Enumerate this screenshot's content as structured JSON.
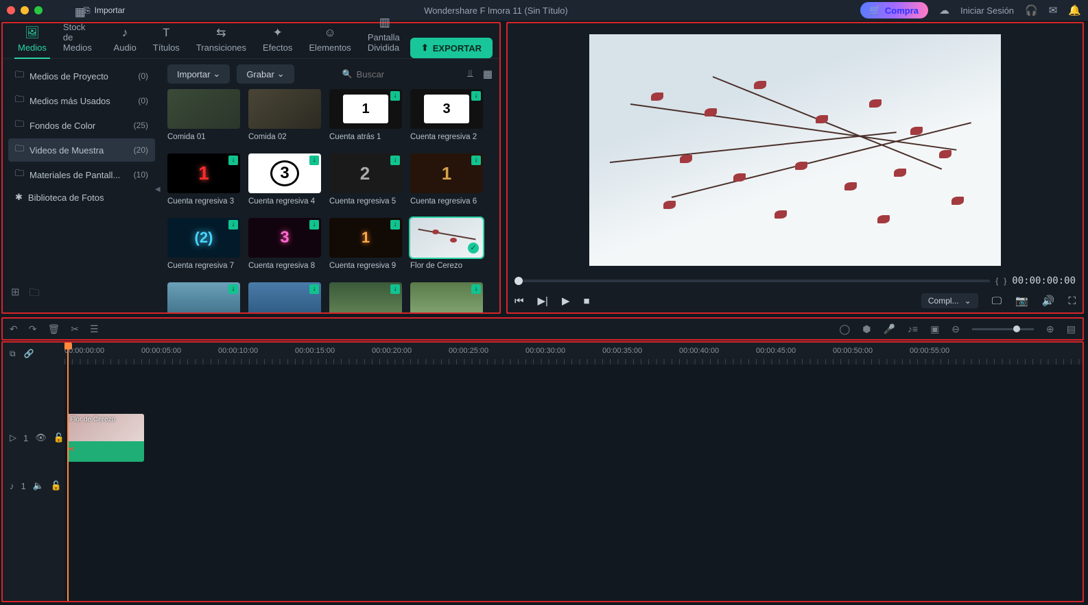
{
  "titlebar": {
    "import": "Importar",
    "app_title": "Wondershare F lmora 11 (Sin Título)",
    "compra": "Compra",
    "login": "Iniciar Sesión"
  },
  "tabs": [
    {
      "label": "Medios",
      "active": true
    },
    {
      "label": "Stock de Medios",
      "active": false
    },
    {
      "label": "Audio",
      "active": false
    },
    {
      "label": "Títulos",
      "active": false
    },
    {
      "label": "Transiciones",
      "active": false
    },
    {
      "label": "Efectos",
      "active": false
    },
    {
      "label": "Elementos",
      "active": false
    },
    {
      "label": "Pantalla Dividida",
      "active": false
    }
  ],
  "export": "EXPORTAR",
  "toolbar": {
    "import": "Importar",
    "record": "Grabar",
    "search_placeholder": "Buscar"
  },
  "sidebar": {
    "items": [
      {
        "label": "Medios de Proyecto",
        "count": "(0)",
        "active": false,
        "icon": "folder"
      },
      {
        "label": "Medios más Usados",
        "count": "(0)",
        "active": false,
        "icon": "folder"
      },
      {
        "label": "Fondos de Color",
        "count": "(25)",
        "active": false,
        "icon": "folder"
      },
      {
        "label": "Videos de Muestra",
        "count": "(20)",
        "active": true,
        "icon": "folder"
      },
      {
        "label": "Materiales de Pantall...",
        "count": "(10)",
        "active": false,
        "icon": "folder"
      },
      {
        "label": "Biblioteca de Fotos",
        "count": "",
        "active": false,
        "icon": "sparkle"
      }
    ]
  },
  "thumbs": [
    {
      "label": "Comida 01",
      "dl": false,
      "sel": false,
      "bg": "linear-gradient(140deg,#3b4a38,#2a362a)"
    },
    {
      "label": "Comida 02",
      "dl": false,
      "sel": false,
      "bg": "linear-gradient(140deg,#4a4536,#2c2b22)"
    },
    {
      "label": "Cuenta atrás 1",
      "dl": true,
      "sel": false,
      "bg": "#111",
      "extra": "count1"
    },
    {
      "label": "Cuenta regresiva 2",
      "dl": true,
      "sel": false,
      "bg": "#111",
      "extra": "count3w"
    },
    {
      "label": "Cuenta regresiva 3",
      "dl": true,
      "sel": false,
      "bg": "#000",
      "extra": "red1"
    },
    {
      "label": "Cuenta regresiva 4",
      "dl": true,
      "sel": false,
      "bg": "#fff",
      "extra": "blk3"
    },
    {
      "label": "Cuenta regresiva 5",
      "dl": true,
      "sel": false,
      "bg": "#1a1a1a",
      "extra": "gray2"
    },
    {
      "label": "Cuenta regresiva 6",
      "dl": true,
      "sel": false,
      "bg": "#26140a",
      "extra": "gold1"
    },
    {
      "label": "Cuenta regresiva 7",
      "dl": true,
      "sel": false,
      "bg": "#031a2a",
      "extra": "blue2"
    },
    {
      "label": "Cuenta regresiva 8",
      "dl": true,
      "sel": false,
      "bg": "#12040e",
      "extra": "pink3"
    },
    {
      "label": "Cuenta regresiva 9",
      "dl": true,
      "sel": false,
      "bg": "#120a04",
      "extra": "orange"
    },
    {
      "label": "Flor de Cerezo",
      "dl": false,
      "sel": true,
      "bg": "linear-gradient(150deg,#d1dce2,#f0f3f4)",
      "extra": "cherry"
    },
    {
      "label": "",
      "dl": true,
      "sel": false,
      "bg": "linear-gradient(#6aa0b8,#3a6a82)"
    },
    {
      "label": "",
      "dl": true,
      "sel": false,
      "bg": "linear-gradient(#4a7aa8,#28557a)"
    },
    {
      "label": "",
      "dl": true,
      "sel": false,
      "bg": "linear-gradient(#3a5a3a,#6a8a5a)"
    },
    {
      "label": "",
      "dl": true,
      "sel": false,
      "bg": "linear-gradient(#5a7a4a,#8aae7a)"
    }
  ],
  "preview": {
    "timecode": "00:00:00:00",
    "quality": "Compl...",
    "brace_l": "{",
    "brace_r": "}"
  },
  "ruler": [
    "00:00:00:00",
    "00:00:05:00",
    "00:00:10:00",
    "00:00:15:00",
    "00:00:20:00",
    "00:00:25:00",
    "00:00:30:00",
    "00:00:35:00",
    "00:00:40:00",
    "00:00:45:00",
    "00:00:50:00",
    "00:00:55:00"
  ],
  "timeline": {
    "video_track": "1",
    "audio_track": "1",
    "clip_label": "Flor de Cerezo"
  }
}
